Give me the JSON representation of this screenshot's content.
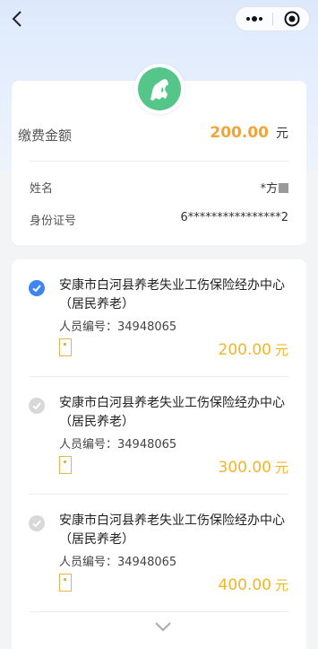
{
  "nav": {
    "back_icon": "chevron-left-icon",
    "more_icon": "more-dots-icon",
    "close_icon": "target-circle-icon"
  },
  "summary": {
    "logo_icon": "social-insurance-logo",
    "amount_label": "缴费金额",
    "amount_value": "200.00",
    "amount_unit": "元",
    "name_label": "姓名",
    "name_value": "*方",
    "id_label": "身份证号",
    "id_value": "6****************2"
  },
  "items": [
    {
      "selected": true,
      "org_line1": "安康市白河县养老失业工伤保险经办中心",
      "org_line2": "（居民养老）",
      "person_id": "人员编号：34948065",
      "price": "200.00",
      "unit": "元"
    },
    {
      "selected": false,
      "org_line1": "安康市白河县养老失业工伤保险经办中心",
      "org_line2": "（居民养老）",
      "person_id": "人员编号：34948065",
      "price": "300.00",
      "unit": "元"
    },
    {
      "selected": false,
      "org_line1": "安康市白河县养老失业工伤保险经办中心",
      "org_line2": "（居民养老）",
      "person_id": "人员编号：34948065",
      "price": "400.00",
      "unit": "元"
    }
  ],
  "expand_icon": "chevron-down-icon",
  "colors": {
    "accent_orange": "#f0a43a",
    "accent_blue": "#3e85f0",
    "logo_green": "#55c58a",
    "header_bg": "#dde9fb"
  }
}
